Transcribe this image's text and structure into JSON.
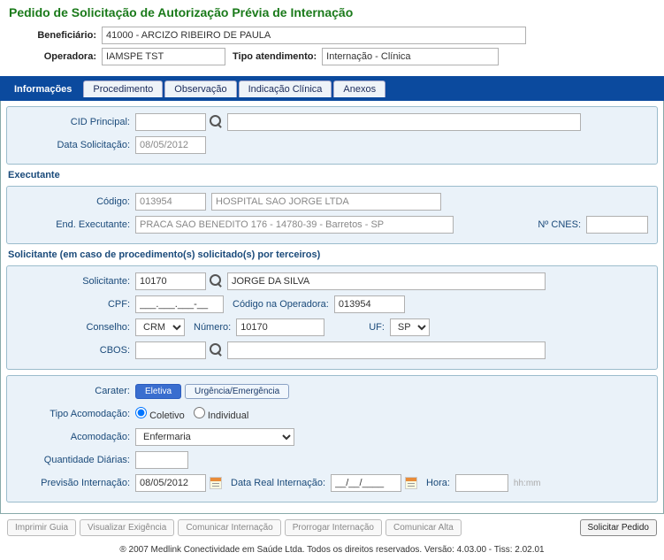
{
  "title": "Pedido de Solicitação de Autorização Prévia de Internação",
  "header": {
    "beneficiario_label": "Beneficiário:",
    "beneficiario": "41000 - ARCIZO RIBEIRO DE PAULA",
    "operadora_label": "Operadora:",
    "operadora": "IAMSPE TST",
    "tipo_atendimento_label": "Tipo atendimento:",
    "tipo_atendimento": "Internação - Clínica"
  },
  "tabs": {
    "t0": "Informações",
    "t1": "Procedimento",
    "t2": "Observação",
    "t3": "Indicação Clínica",
    "t4": "Anexos"
  },
  "info": {
    "cid_label": "CID Principal:",
    "cid_code": "",
    "cid_desc": "",
    "data_sol_label": "Data Solicitação:",
    "data_sol": "08/05/2012"
  },
  "executante": {
    "section": "Executante",
    "codigo_label": "Código:",
    "codigo": "013954",
    "nome": "HOSPITAL SAO JORGE LTDA",
    "end_label": "End. Executante:",
    "endereco": "PRACA SAO BENEDITO 176 - 14780-39 - Barretos - SP",
    "cnes_label": "Nº CNES:",
    "cnes": ""
  },
  "solicitante": {
    "section": "Solicitante (em caso de procedimento(s) solicitado(s) por terceiros)",
    "solicitante_label": "Solicitante:",
    "solicitante_code": "10170",
    "solicitante_nome": "JORGE DA SILVA",
    "cpf_label": "CPF:",
    "cpf": "___.___.___-__",
    "cod_op_label": "Código na Operadora:",
    "cod_op": "013954",
    "conselho_label": "Conselho:",
    "conselho": "CRM",
    "numero_label": "Número:",
    "numero": "10170",
    "uf_label": "UF:",
    "uf": "SP",
    "cbos_label": "CBOS:",
    "cbos_code": "",
    "cbos_desc": ""
  },
  "internacao": {
    "carater_label": "Carater:",
    "carater_eletiva": "Eletiva",
    "carater_urg": "Urgência/Emergência",
    "tipo_acom_label": "Tipo Acomodação:",
    "tipo_acom_coletivo": "Coletivo",
    "tipo_acom_individual": "Individual",
    "acomodacao_label": "Acomodação:",
    "acomodacao": "Enfermaria",
    "qtd_label": "Quantidade Diárias:",
    "qtd": "",
    "prev_label": "Previsão Internação:",
    "prev": "08/05/2012",
    "real_label": "Data Real Internação:",
    "real": "__/__/____",
    "hora_label": "Hora:",
    "hora": "",
    "hhmm": "hh:mm"
  },
  "footer": {
    "b0": "Imprimir Guia",
    "b1": "Visualizar Exigência",
    "b2": "Comunicar Internação",
    "b3": "Prorrogar Internação",
    "b4": "Comunicar Alta",
    "submit": "Solicitar Pedido"
  },
  "copyright": "® 2007  Medlink Conectividade em Saúde Ltda.  Todos os direitos reservados.   Versão: 4.03.00 - Tiss: 2.02.01"
}
